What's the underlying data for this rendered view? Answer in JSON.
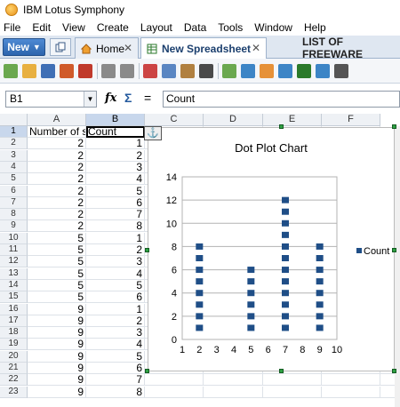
{
  "window": {
    "title": "IBM Lotus Symphony"
  },
  "menu": [
    "File",
    "Edit",
    "View",
    "Create",
    "Layout",
    "Data",
    "Tools",
    "Window",
    "Help"
  ],
  "tabs": {
    "new_label": "New",
    "home_label": "Home",
    "sheet_label": "New Spreadsheet",
    "other_label": "LIST OF FREEWARE"
  },
  "formula": {
    "cell_ref": "B1",
    "content": "Count"
  },
  "columns": [
    "A",
    "B",
    "C",
    "D",
    "E",
    "F"
  ],
  "rows": [
    {
      "n": "1",
      "a": "Number of sn",
      "b": "Count"
    },
    {
      "n": "2",
      "a": "2",
      "b": "1"
    },
    {
      "n": "3",
      "a": "2",
      "b": "2"
    },
    {
      "n": "4",
      "a": "2",
      "b": "3"
    },
    {
      "n": "5",
      "a": "2",
      "b": "4"
    },
    {
      "n": "6",
      "a": "2",
      "b": "5"
    },
    {
      "n": "7",
      "a": "2",
      "b": "6"
    },
    {
      "n": "8",
      "a": "2",
      "b": "7"
    },
    {
      "n": "9",
      "a": "2",
      "b": "8"
    },
    {
      "n": "10",
      "a": "5",
      "b": "1"
    },
    {
      "n": "11",
      "a": "5",
      "b": "2"
    },
    {
      "n": "12",
      "a": "5",
      "b": "3"
    },
    {
      "n": "13",
      "a": "5",
      "b": "4"
    },
    {
      "n": "14",
      "a": "5",
      "b": "5"
    },
    {
      "n": "15",
      "a": "5",
      "b": "6"
    },
    {
      "n": "16",
      "a": "9",
      "b": "1"
    },
    {
      "n": "17",
      "a": "9",
      "b": "2"
    },
    {
      "n": "18",
      "a": "9",
      "b": "3"
    },
    {
      "n": "19",
      "a": "9",
      "b": "4"
    },
    {
      "n": "20",
      "a": "9",
      "b": "5"
    },
    {
      "n": "21",
      "a": "9",
      "b": "6"
    },
    {
      "n": "22",
      "a": "9",
      "b": "7"
    },
    {
      "n": "23",
      "a": "9",
      "b": "8"
    }
  ],
  "chart_data": {
    "type": "scatter",
    "title": "Dot Plot Chart",
    "xlim": [
      1,
      10
    ],
    "ylim": [
      0,
      14
    ],
    "xticks": [
      "1",
      "2",
      "3",
      "4",
      "5",
      "6",
      "7",
      "8",
      "9",
      "10"
    ],
    "yticks": [
      "0",
      "2",
      "4",
      "6",
      "8",
      "10",
      "12",
      "14"
    ],
    "legend": "Count",
    "legend_position": "right",
    "marker_color": "#1f4e87",
    "series": [
      {
        "name": "Count",
        "points": [
          [
            2,
            1
          ],
          [
            2,
            2
          ],
          [
            2,
            3
          ],
          [
            2,
            4
          ],
          [
            2,
            5
          ],
          [
            2,
            6
          ],
          [
            2,
            7
          ],
          [
            2,
            8
          ],
          [
            5,
            1
          ],
          [
            5,
            2
          ],
          [
            5,
            3
          ],
          [
            5,
            4
          ],
          [
            5,
            5
          ],
          [
            5,
            6
          ],
          [
            7,
            1
          ],
          [
            7,
            2
          ],
          [
            7,
            3
          ],
          [
            7,
            4
          ],
          [
            7,
            5
          ],
          [
            7,
            6
          ],
          [
            7,
            7
          ],
          [
            7,
            8
          ],
          [
            7,
            9
          ],
          [
            7,
            10
          ],
          [
            7,
            11
          ],
          [
            7,
            12
          ],
          [
            9,
            1
          ],
          [
            9,
            2
          ],
          [
            9,
            3
          ],
          [
            9,
            4
          ],
          [
            9,
            5
          ],
          [
            9,
            6
          ],
          [
            9,
            7
          ],
          [
            9,
            8
          ]
        ]
      }
    ]
  }
}
